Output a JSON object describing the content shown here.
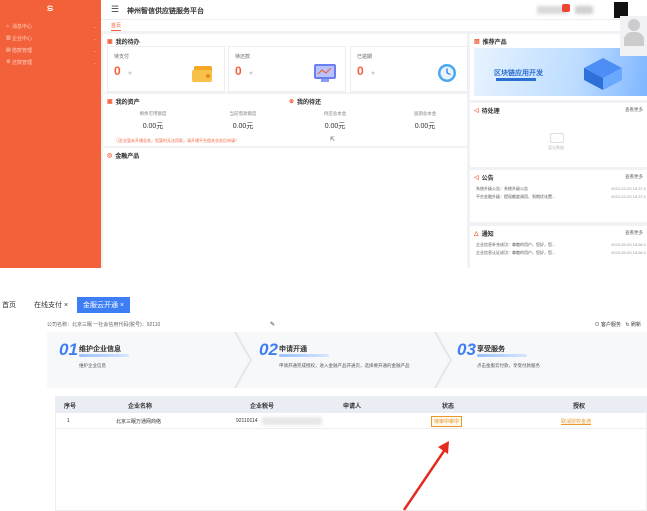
{
  "top": {
    "app_title": "神州智信供应链服务平台",
    "home_tab": "首页",
    "sidebar": {
      "items": [
        {
          "icon": "home-icon",
          "label": "消息中心"
        },
        {
          "icon": "building-icon",
          "label": "企业中心"
        },
        {
          "icon": "doc-icon",
          "label": "借款管理"
        },
        {
          "icon": "settings-icon",
          "label": "还款管理"
        }
      ]
    },
    "todo": {
      "title": "我的待办",
      "items": [
        {
          "label": "待支付",
          "value": "0",
          "unit": "个"
        },
        {
          "label": "待还款",
          "value": "0",
          "unit": "个"
        },
        {
          "label": "已逾期",
          "value": "0",
          "unit": "个"
        }
      ]
    },
    "assets": {
      "title": "我的资产",
      "items": [
        {
          "label": "剩余可用额度",
          "value": "0.00元"
        },
        {
          "label": "当前借款额度",
          "value": "0.00元"
        }
      ],
      "warning": "企业暂未开通业务，您暂时无法用款，请开通平台相关业务后申请！"
    },
    "repay": {
      "title": "我的待还",
      "items": [
        {
          "label": "待还总本金",
          "value": "0.00元"
        },
        {
          "label": "逾期总本金",
          "value": "0.00元"
        }
      ]
    },
    "finance": {
      "title": "金融产品"
    },
    "recommend": {
      "title": "推荐产品",
      "banner": "区块链应用开发"
    },
    "pending": {
      "title": "待处理",
      "more": "查看更多",
      "empty": "暂无数据"
    },
    "notice": {
      "title": "公告",
      "more": "查看更多",
      "items": [
        {
          "text": "系统升级公告：系统升级公告",
          "date": "2022-03-29 16:37:2"
        },
        {
          "text": "平台金融升级：提现额度调用、到期优化置...",
          "date": "2022-03-29 16:37:1"
        }
      ]
    },
    "notify": {
      "title": "通知",
      "more": "查看更多",
      "items": [
        {
          "text": "企业信息补充成功：尊敬的用户，您好，您...",
          "date": "2023-05-09 18:56:2"
        },
        {
          "text": "企业信息认证成功：尊敬的用户，您好，您...",
          "date": "2023-05-09 18:56:2"
        }
      ]
    }
  },
  "bottom": {
    "tabs": [
      {
        "label": "首页"
      },
      {
        "label": "在线支付 ×"
      },
      {
        "label": "金服云开通 ×"
      }
    ],
    "company_line": "公司名称：北京三眠        一社会信用代码(税号)：92110",
    "service_link": "客户服务",
    "refresh_link": "刷新",
    "steps": [
      {
        "num": "01",
        "title": "维护企业信息",
        "desc": "维护企业信息"
      },
      {
        "num": "02",
        "title": "申请开通",
        "desc": "申请开通完成授权，进入金融产品开通页，选择要开通的金融产品"
      },
      {
        "num": "03",
        "title": "享受服务",
        "desc": "点击金服云付款，享受付款服务"
      }
    ],
    "table": {
      "headers": [
        "序号",
        "企业名称",
        "企业税号",
        "申请人",
        "状态",
        "授权"
      ],
      "rows": [
        {
          "index": "1",
          "name": "北京三眠万通网商络",
          "tax": "92110114",
          "applicant": "",
          "status": "待审中审中",
          "action": "取消授权金通"
        }
      ]
    }
  }
}
